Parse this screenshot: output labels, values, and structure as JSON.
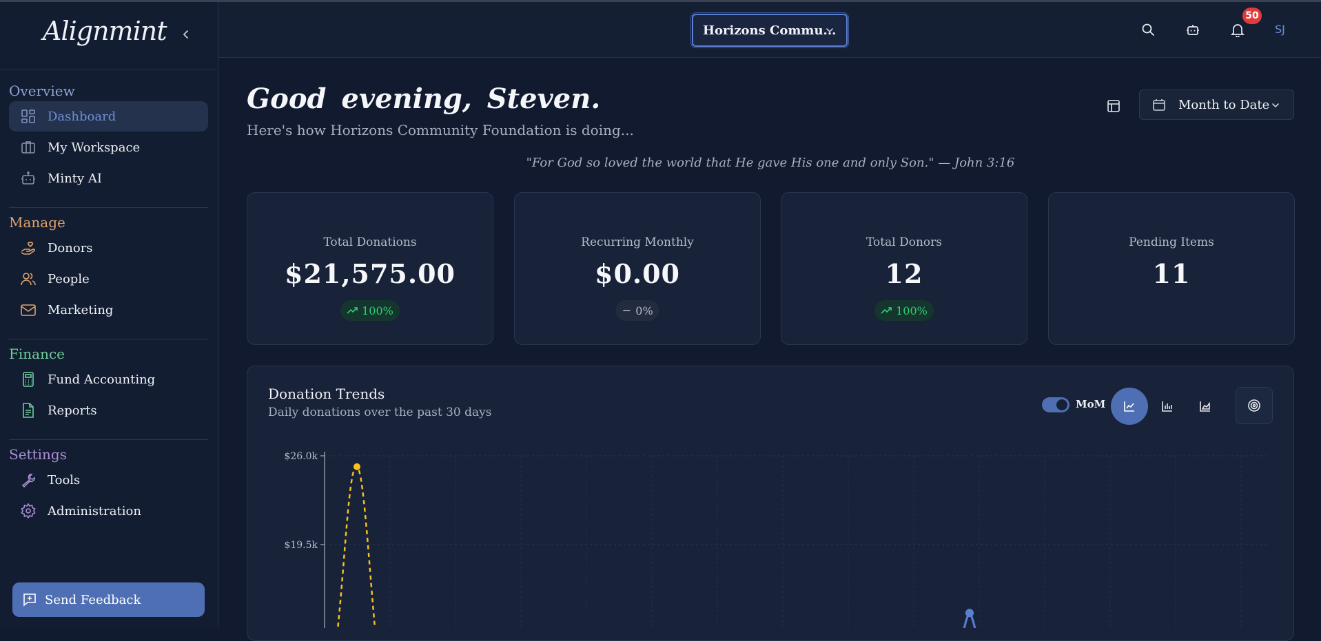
{
  "app": {
    "logo": "Alignmint"
  },
  "sidebar": {
    "sections": [
      {
        "title": "Overview",
        "color": "#8fa6d6"
      },
      {
        "title": "Manage",
        "color": "#e0a36c"
      },
      {
        "title": "Finance",
        "color": "#6fcf9a"
      },
      {
        "title": "Settings",
        "color": "#a98fd6"
      }
    ],
    "items": [
      {
        "label": "Dashboard",
        "icon": "dashboard-grid-icon",
        "active": true
      },
      {
        "label": "My Workspace",
        "icon": "briefcase-icon"
      },
      {
        "label": "Minty AI",
        "icon": "robot-icon"
      },
      {
        "label": "Donors",
        "icon": "hand-heart-icon"
      },
      {
        "label": "People",
        "icon": "users-icon"
      },
      {
        "label": "Marketing",
        "icon": "mail-icon"
      },
      {
        "label": "Fund Accounting",
        "icon": "calculator-icon"
      },
      {
        "label": "Reports",
        "icon": "file-text-icon"
      },
      {
        "label": "Tools",
        "icon": "wrench-icon"
      },
      {
        "label": "Administration",
        "icon": "gear-icon"
      }
    ],
    "feedback_label": "Send Feedback"
  },
  "header": {
    "org_selector": "Horizons Commu...",
    "notification_count": "50",
    "avatar_initials": "SJ"
  },
  "main": {
    "greeting": "Good evening, Steven.",
    "subtitle": "Here's how Horizons Community Foundation is doing...",
    "date_range": "Month to Date",
    "verse": "\"For God so loved the world that He gave His one and only Son.\" — John 3:16"
  },
  "stats": [
    {
      "title": "Total Donations",
      "value": "$21,575.00",
      "change": "100%",
      "trend": "up"
    },
    {
      "title": "Recurring Monthly",
      "value": "$0.00",
      "change": "0%",
      "trend": "flat"
    },
    {
      "title": "Total Donors",
      "value": "12",
      "change": "100%",
      "trend": "up"
    },
    {
      "title": "Pending Items",
      "value": "11",
      "change": null,
      "trend": null
    }
  ],
  "chart_card": {
    "title": "Donation Trends",
    "subtitle": "Daily donations over the past 30 days",
    "toggle_label": "MoM",
    "toggle_on": true
  },
  "chart_data": {
    "type": "line",
    "y_ticks": [
      "$26.0k",
      "$19.5k"
    ],
    "y_tick_values": [
      26000,
      19500
    ],
    "ylim": [
      0,
      26000
    ],
    "grid": true,
    "series": [
      {
        "color": "#f5c020",
        "style": "dashed",
        "peak_point": {
          "x": 2,
          "y": 25200
        }
      },
      {
        "color": "#5b7fd1",
        "style": "solid",
        "peak_point": {
          "x": 20,
          "y": 14500
        }
      }
    ]
  },
  "colors": {
    "accent": "#4f6fb4",
    "positive": "#2fd06f",
    "badge": "#e23b3b"
  }
}
